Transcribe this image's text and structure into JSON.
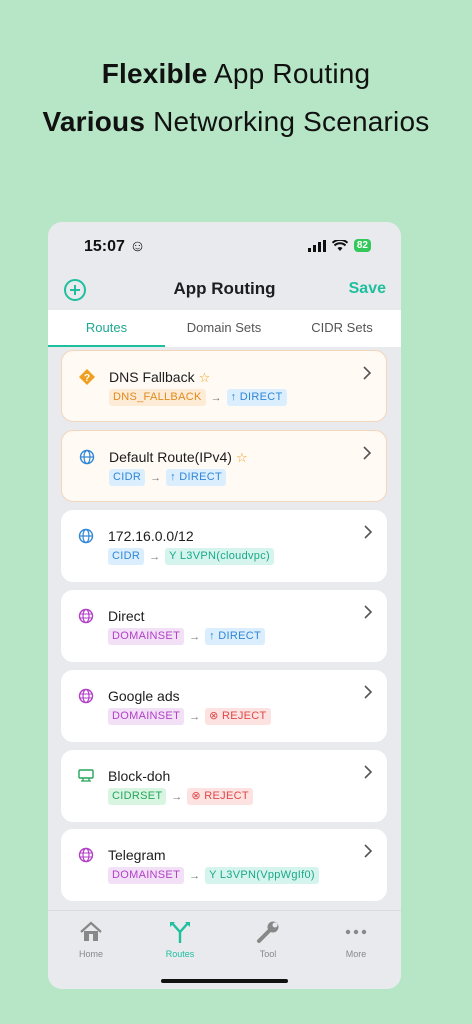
{
  "headline": {
    "line1_bold": "Flexible",
    "line1_rest": " App Routing",
    "line2_bold": "Various",
    "line2_rest": " Networking Scenarios"
  },
  "status_bar": {
    "time": "15:07",
    "emoji": "☺",
    "battery": "82"
  },
  "navbar": {
    "title": "App Routing",
    "save_label": "Save",
    "add_icon": "plus-circle-icon"
  },
  "tabs": [
    {
      "label": "Routes",
      "active": true
    },
    {
      "label": "Domain Sets",
      "active": false
    },
    {
      "label": "CIDR Sets",
      "active": false
    }
  ],
  "routes": [
    {
      "title": "DNS Fallback",
      "star": "☆",
      "icon": "dns-diamond-icon",
      "source": "DNS_FALLBACK",
      "arrow": "→",
      "target": "↑ DIRECT"
    },
    {
      "title": "Default Route(IPv4)",
      "star": "☆",
      "icon": "globe-icon",
      "source": "CIDR",
      "arrow": "→",
      "target": "↑ DIRECT"
    },
    {
      "title": "172.16.0.0/12",
      "icon": "globe-icon",
      "source": "CIDR",
      "arrow": "→",
      "target": "Y L3VPN(cloudvpc)"
    },
    {
      "title": "Direct",
      "icon": "globe-grid-icon",
      "source": "DOMAINSET",
      "arrow": "→",
      "target": "↑ DIRECT"
    },
    {
      "title": "Google ads",
      "icon": "globe-grid-icon",
      "source": "DOMAINSET",
      "arrow": "→",
      "target": "⊗ REJECT"
    },
    {
      "title": "Block-doh",
      "icon": "network-icon",
      "source": "CIDRSET",
      "arrow": "→",
      "target": "⊗ REJECT"
    },
    {
      "title": "Telegram",
      "icon": "globe-grid-icon",
      "source": "DOMAINSET",
      "arrow": "→",
      "target": "Y L3VPN(VppWgIf0)"
    }
  ],
  "tabbar": [
    {
      "label": "Home",
      "icon": "home-icon",
      "active": false
    },
    {
      "label": "Routes",
      "icon": "routes-icon",
      "active": true
    },
    {
      "label": "Tool",
      "icon": "wrench-icon",
      "active": false
    },
    {
      "label": "More",
      "icon": "more-icon",
      "active": false
    }
  ],
  "colors": {
    "accent": "#1fbf9e",
    "background": "#b6e6c6"
  }
}
